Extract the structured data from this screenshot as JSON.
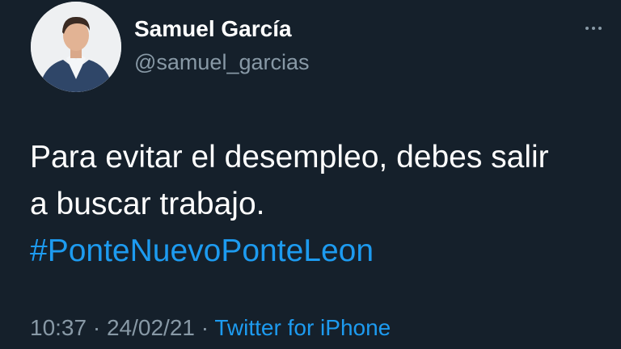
{
  "tweet": {
    "display_name": "Samuel García",
    "handle": "@samuel_garcias",
    "text_line1": "Para evitar el desempleo, debes salir",
    "text_line2": "a buscar trabajo.",
    "hashtag": "#PonteNuevoPonteLeon",
    "time": "10:37",
    "separator1": " · ",
    "date": "24/02/21",
    "separator2": " · ",
    "source": "Twitter for iPhone"
  },
  "icons": {
    "more": "more-options-icon",
    "avatar": "profile-photo"
  },
  "colors": {
    "background": "#15202b",
    "text_primary": "#ffffff",
    "text_secondary": "#8899a6",
    "accent": "#1d9bf0"
  }
}
